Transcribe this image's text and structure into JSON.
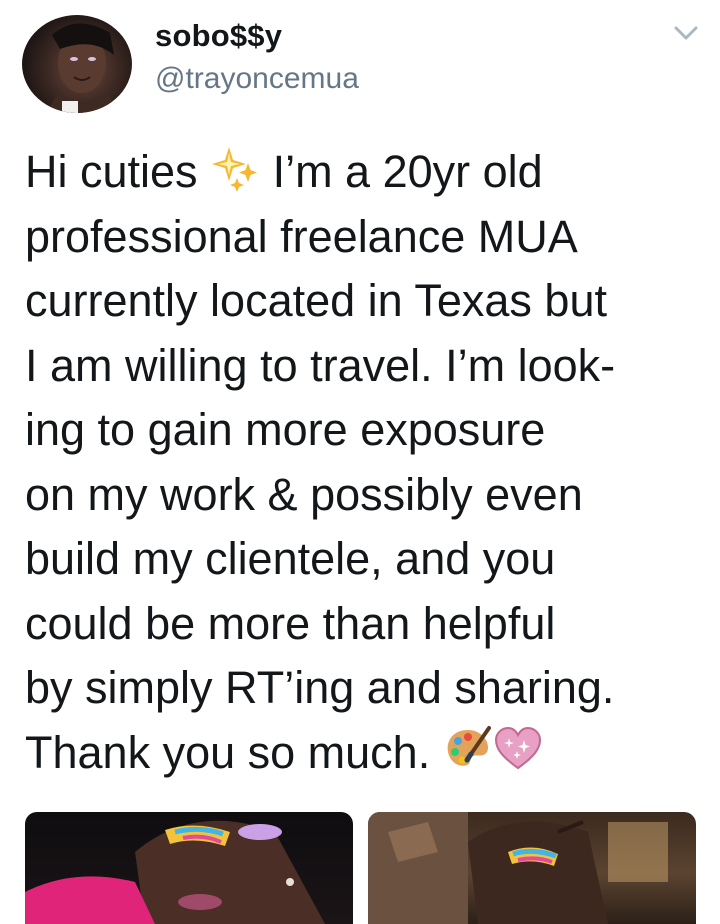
{
  "user": {
    "display_name": "sobo$$y",
    "handle": "@trayoncemua"
  },
  "tweet": {
    "lines": [
      {
        "before": "Hi cuties ",
        "emoji": "sparkles-emoji",
        "after": " I’m a 20yr old"
      },
      {
        "text": "professional freelance MUA"
      },
      {
        "text": "currently located in Texas but"
      },
      {
        "text": "I am willing to travel. I’m look-"
      },
      {
        "text": "ing to gain more exposure"
      },
      {
        "text": "on my work & possibly even"
      },
      {
        "text": "build my clientele, and you"
      },
      {
        "text": "could be more than helpful"
      },
      {
        "text": "by simply RT’ing and sharing."
      },
      {
        "before": "Thank you so much. ",
        "emojis": [
          "artist-palette-emoji",
          "sparkling-heart-emoji"
        ]
      }
    ]
  },
  "icons": {
    "more": "chevron-down-icon",
    "sparkles": "sparkles-emoji",
    "palette": "artist-palette-emoji",
    "heart": "sparkling-heart-emoji"
  },
  "media": [
    {
      "name": "photo-1",
      "subject": "makeup-look-photo"
    },
    {
      "name": "photo-2",
      "subject": "makeup-look-photo"
    }
  ],
  "colors": {
    "text": "#14171a",
    "secondary": "#657786",
    "sparkle": "#f7b731",
    "heart": "#e8a0c4"
  }
}
